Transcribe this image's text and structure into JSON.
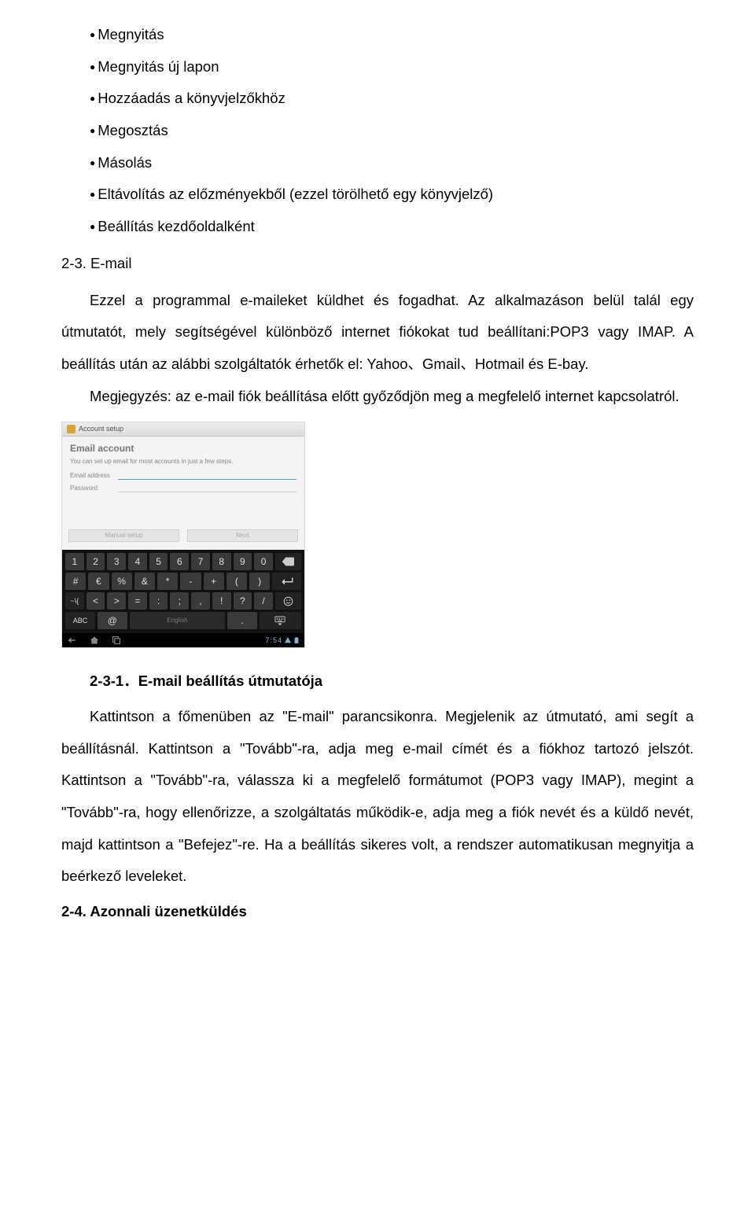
{
  "bullets": {
    "b0": "Megnyitás",
    "b1": "Megnyitás új lapon",
    "b2": "Hozzáadás a könyvjelzőkhöz",
    "b3": "Megosztás",
    "b4": "Másolás",
    "b5": "Eltávolítás az előzményekből (ezzel törölhető egy könyvjelző)",
    "b6": "Beállítás kezdőoldalként"
  },
  "section23": {
    "heading": "2-3. E-mail",
    "p1": "Ezzel a programmal e-maileket küldhet és fogadhat. Az alkalmazáson belül talál egy útmutatót, mely segítségével különböző internet fiókokat tud beállítani:POP3 vagy IMAP. A beállítás után az alábbi szolgáltatók érhetők el: Yahoo、Gmail、Hotmail és E-bay.",
    "p2": "Megjegyzés: az e-mail fiók beállítása előtt győződjön meg a megfelelő internet kapcsolatról."
  },
  "screenshot": {
    "header": "Account setup",
    "title": "Email account",
    "subtitle": "You can set up email for most accounts in just a few steps.",
    "field1": "Email address",
    "field2": "Password",
    "btn1": "Manual setup",
    "btn2": "Next",
    "row1": [
      "1",
      "2",
      "3",
      "4",
      "5",
      "6",
      "7",
      "8",
      "9",
      "0"
    ],
    "row2": [
      "#",
      "€",
      "%",
      "&",
      "*",
      "-",
      "+",
      "(",
      ")"
    ],
    "row3": [
      "~\\{",
      "<",
      ">",
      "=",
      ":",
      ";",
      ",",
      "!",
      "?",
      "/"
    ],
    "row4_left": "ABC",
    "row4_at": "@",
    "row4_space": "English",
    "row4_dot": ".",
    "time": "7:54"
  },
  "section231": {
    "heading": "2-3-1．E-mail beállítás útmutatója",
    "p1": "Kattintson a főmenüben az \"E-mail\" parancsikonra. Megjelenik az útmutató, ami segít a beállításnál. Kattintson a \"Tovább\"-ra, adja meg e-mail címét és a fiókhoz tartozó jelszót. Kattintson a \"Tovább\"-ra, válassza ki a megfelelő formátumot (POP3 vagy IMAP), megint a \"Tovább\"-ra, hogy ellenőrizze, a szolgáltatás működik-e, adja meg a  fiók nevét és a küldő nevét, majd kattintson a \"Befejez\"-re. Ha a beállítás sikeres volt, a rendszer automatikusan megnyitja a beérkező leveleket."
  },
  "section24": {
    "heading": "2-4. Azonnali üzenetküldés"
  }
}
